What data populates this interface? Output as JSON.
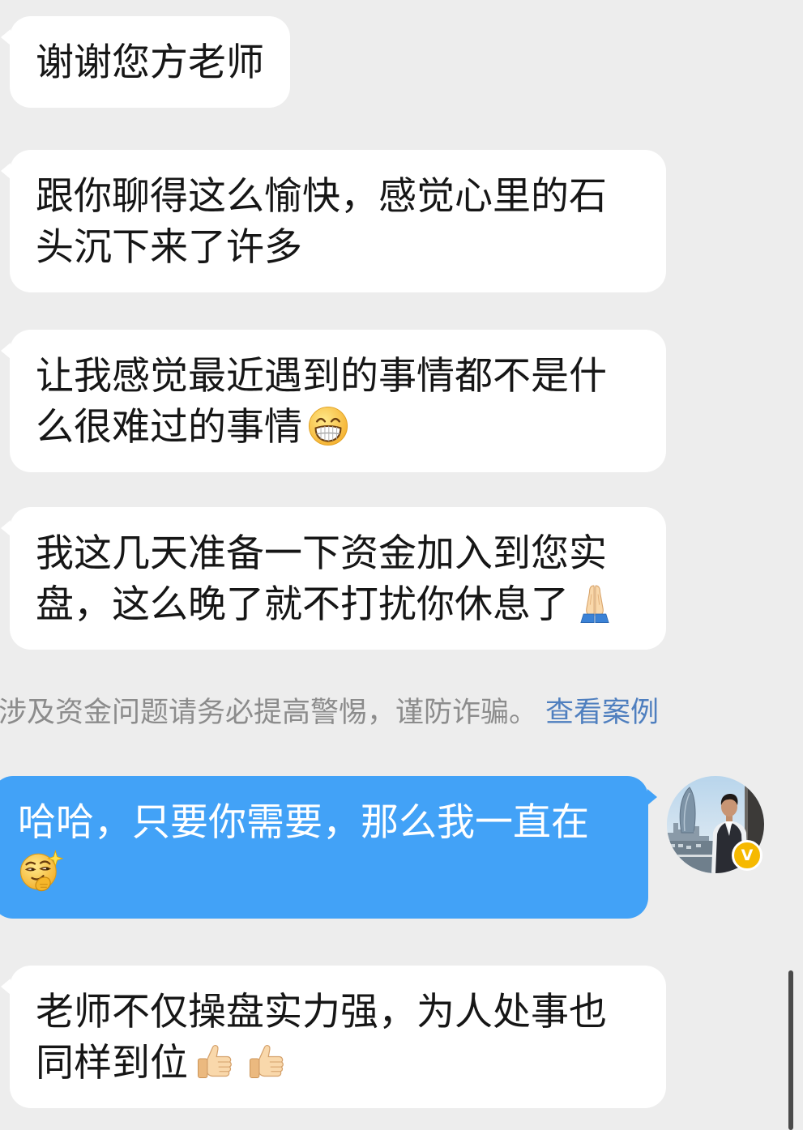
{
  "colors": {
    "background": "#ededed",
    "bubble_left": "#ffffff",
    "bubble_right": "#42a2f7",
    "notice_text": "#8c8c8c",
    "link": "#4f7fbf",
    "badge": "#f6b900"
  },
  "messages": [
    {
      "side": "left",
      "text": "谢谢您方老师",
      "emojis": []
    },
    {
      "side": "left",
      "text": "跟你聊得这么愉快，感觉心里的石头沉下来了许多",
      "emojis": []
    },
    {
      "side": "left",
      "text": "让我感觉最近遇到的事情都不是什么很难过的事情",
      "emojis": [
        "grinning-face"
      ]
    },
    {
      "side": "left",
      "text": "我这几天准备一下资金加入到您实盘，这么晚了就不打扰你休息了",
      "emojis": [
        "folded-hands"
      ]
    },
    {
      "side": "right",
      "text": "哈哈，只要你需要，那么我一直在",
      "emojis": [
        "smart-face-with-sparkle"
      ]
    },
    {
      "side": "left",
      "text": "老师不仅操盘实力强，为人处事也同样到位",
      "emojis": [
        "thumbs-up",
        "thumbs-up"
      ]
    }
  ],
  "notice": {
    "text": "涉及资金问题请务必提高警惕，谨防诈骗。",
    "link": "查看案例"
  },
  "avatar": {
    "badge": "V",
    "badge_icon": "verified-badge"
  }
}
